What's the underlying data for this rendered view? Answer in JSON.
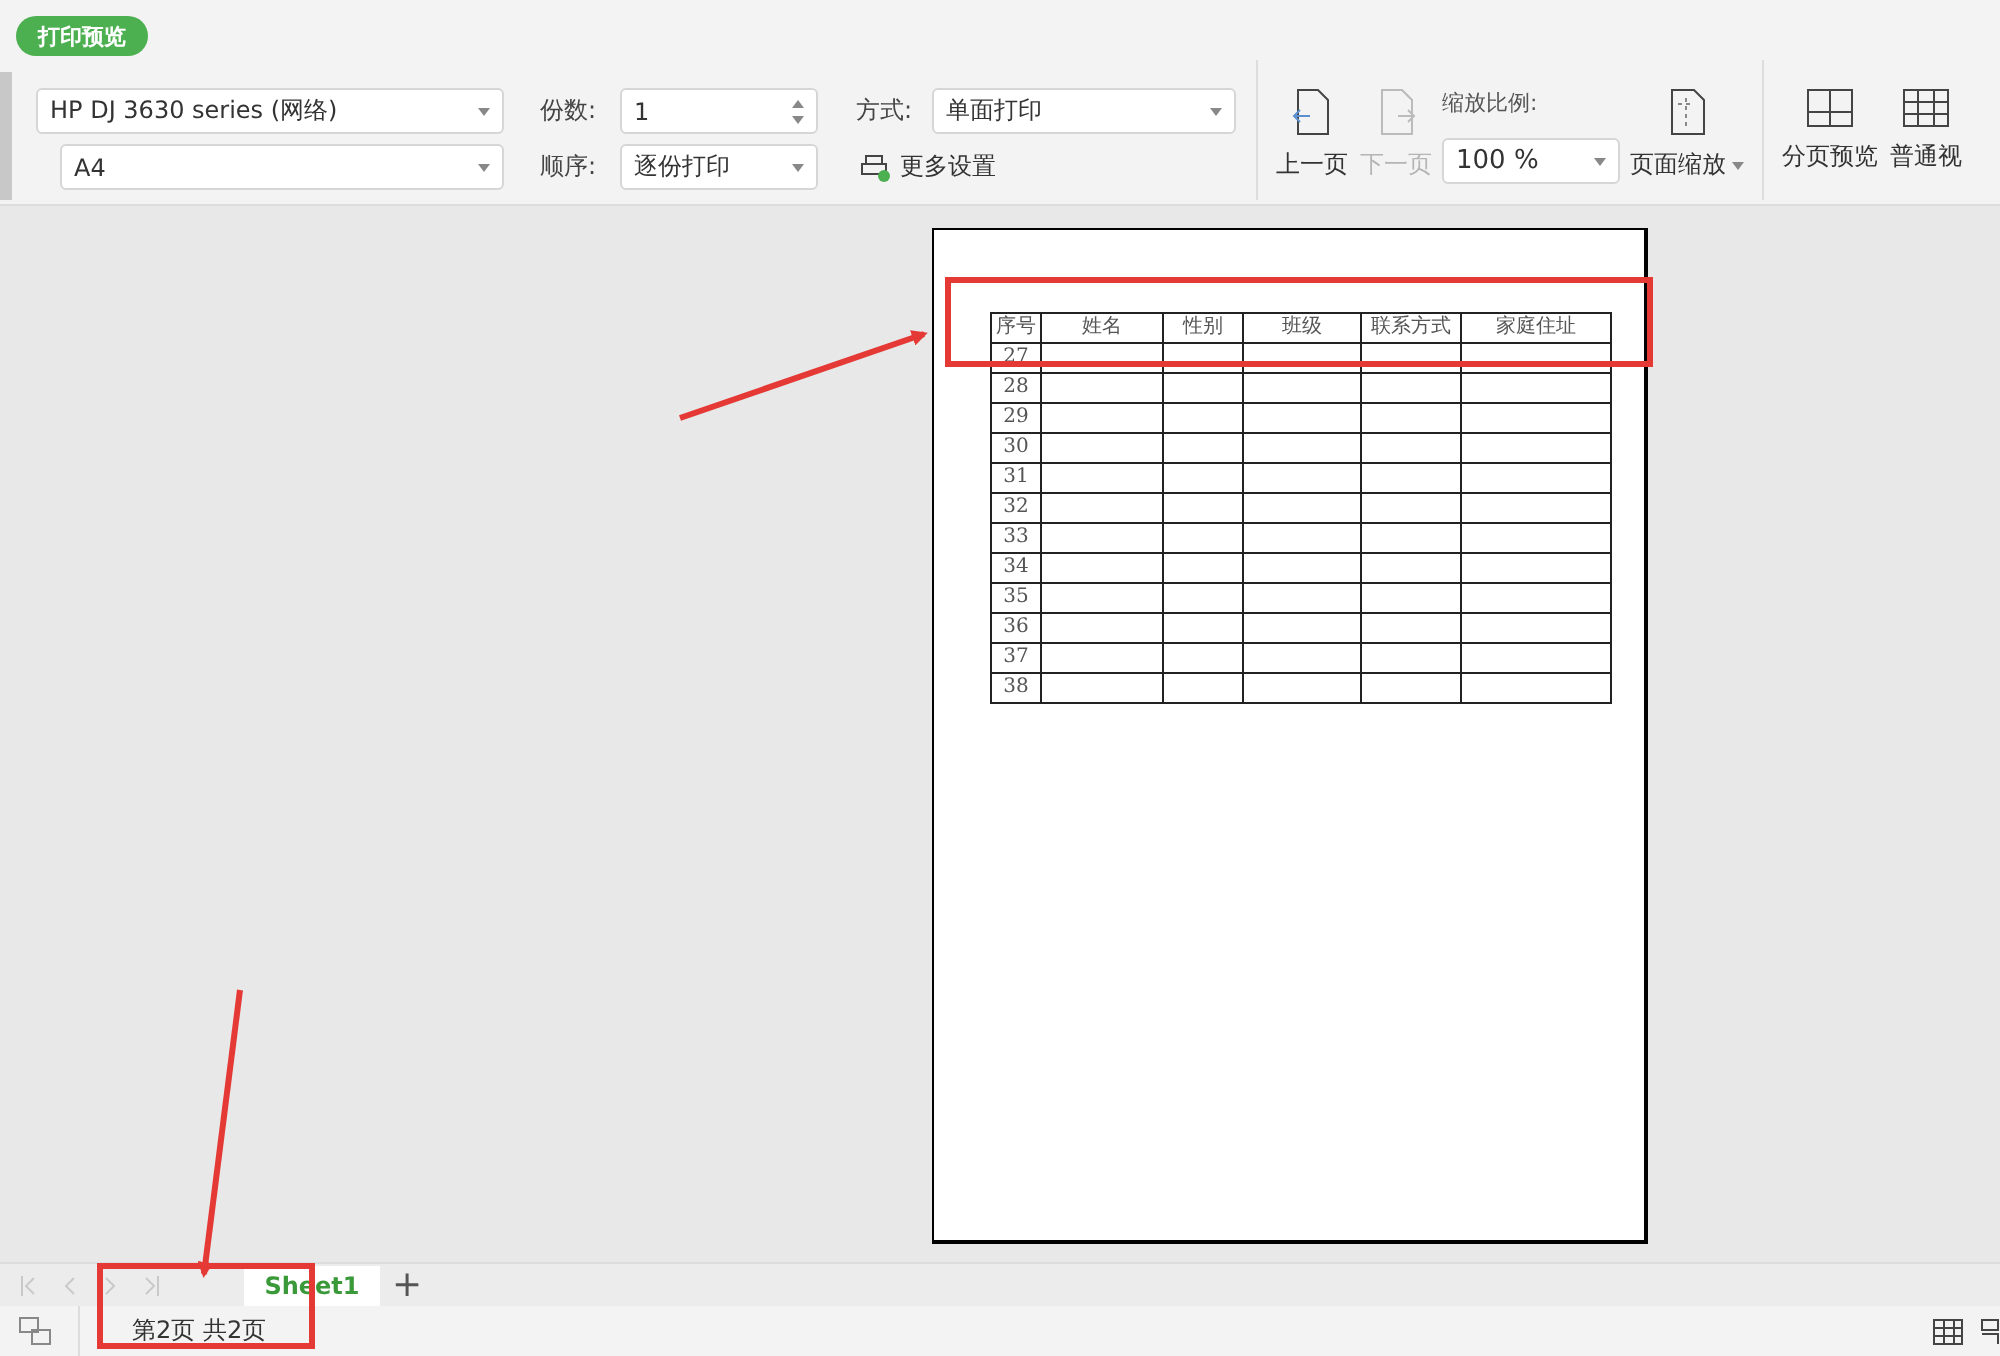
{
  "badge": "打印预览",
  "printer": {
    "value": "HP DJ 3630 series (网络)"
  },
  "paper": {
    "value": "A4"
  },
  "copies": {
    "label": "份数:",
    "value": "1"
  },
  "order": {
    "label": "顺序:",
    "value": "逐份打印"
  },
  "mode": {
    "label": "方式:",
    "value": "单面打印"
  },
  "more_settings": "更多设置",
  "nav": [
    {
      "label": "上一页",
      "disabled": false
    },
    {
      "label": "下一页",
      "disabled": true
    }
  ],
  "zoom": {
    "label": "缩放比例:",
    "value": "100 %"
  },
  "page_zoom": "页面缩放",
  "views": [
    {
      "label": "分页预览",
      "kind": "split"
    },
    {
      "label": "普通视",
      "kind": "grid"
    }
  ],
  "page": {
    "columns": [
      "序号",
      "姓名",
      "性别",
      "班级",
      "联系方式",
      "家庭住址"
    ],
    "rows": [
      "27",
      "28",
      "29",
      "30",
      "31",
      "32",
      "33",
      "34",
      "35",
      "36",
      "37",
      "38"
    ]
  },
  "sheet_tabs": [
    {
      "label": "Sheet1",
      "selected": true
    }
  ],
  "add_sheet": "+",
  "status": "第2页 共2页"
}
